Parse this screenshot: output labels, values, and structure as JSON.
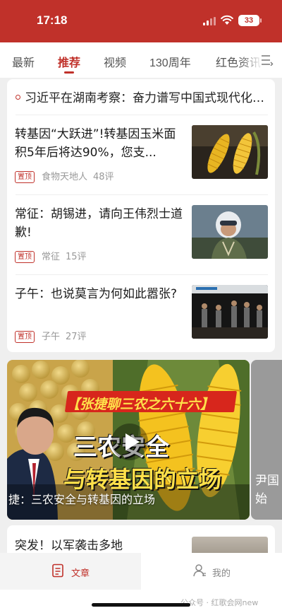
{
  "status_bar": {
    "time": "17:18",
    "battery": "33"
  },
  "tabs": [
    {
      "label": "最新"
    },
    {
      "label": "推荐"
    },
    {
      "label": "视频"
    },
    {
      "label": "130周年"
    },
    {
      "label": "红色资讯"
    }
  ],
  "active_tab": "推荐",
  "top_headline": "习近平在湖南考察：奋力谱写中国式现代化湖南篇章",
  "articles": [
    {
      "title": "转基因“大跃进”!转基因玉米面积5年后将达90%，您支...",
      "pin": "置顶",
      "source": "食物天地人",
      "comments": "48评",
      "thumb": "corn-icon"
    },
    {
      "title": "常征：胡锡进，请向王伟烈士道歉!",
      "pin": "置顶",
      "source": "常征",
      "comments": "15评",
      "thumb": "pilot-icon"
    },
    {
      "title": "子午：也说莫言为何如此嚣张?",
      "pin": "置顶",
      "source": "子午",
      "comments": "27评",
      "thumb": "stage-icon"
    }
  ],
  "video_banner": {
    "red_banner": "【张捷聊三农之六十六】",
    "big_line1": "三农安全",
    "big_line2": "与转基因的立场",
    "caption": "捷：三农安全与转基因的立场",
    "next_card_text": [
      "尹国",
      "始"
    ]
  },
  "second_card": {
    "title": "突发！以军袭击多地"
  },
  "bottom_nav": [
    {
      "label": "文章",
      "icon": "article-icon"
    },
    {
      "label": "我的",
      "icon": "profile-icon"
    }
  ],
  "watermark": "公众号 · 红歌会网new",
  "colors": {
    "brand_red": "#c0312a",
    "banner_yellow": "#ffe14a"
  }
}
